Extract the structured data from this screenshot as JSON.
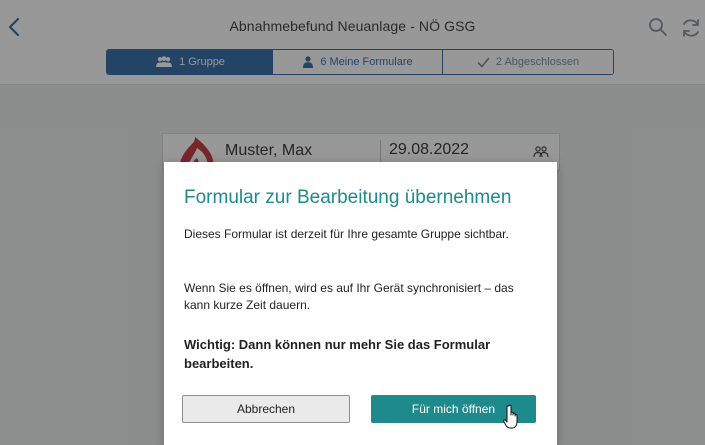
{
  "header": {
    "back_icon": "chevron-left-icon",
    "title": "Abnahmebefund Neuanlage - NÖ GSG",
    "search_icon": "search-icon",
    "sync_icon": "sync-icon"
  },
  "segments": {
    "group": {
      "label": "1 Gruppe",
      "icon": "group-icon"
    },
    "mine": {
      "label": "6 Meine Formulare",
      "icon": "person-icon"
    },
    "done": {
      "label": "2 Abgeschlossen",
      "icon": "check-icon"
    }
  },
  "card": {
    "name": "Muster, Max",
    "date": "29.08.2022",
    "group_icon": "group-icon"
  },
  "modal": {
    "title": "Formular zur Bearbeitung übernehmen",
    "paragraphs": [
      "Dieses Formular ist derzeit für Ihre gesamte Gruppe sichtbar.",
      "Wenn Sie es öffnen, wird es auf Ihr Gerät synchronisiert – das kann kurze Zeit dauern.",
      "Wichtig: Dann können nur mehr Sie das Formular bearbeiten."
    ],
    "cancel_label": "Abbrechen",
    "open_label": "Für mich öffnen"
  },
  "colors": {
    "primary_blue": "#1f5f9e",
    "accent_teal": "#1e8a8c",
    "logo_red": "#c0272d"
  }
}
